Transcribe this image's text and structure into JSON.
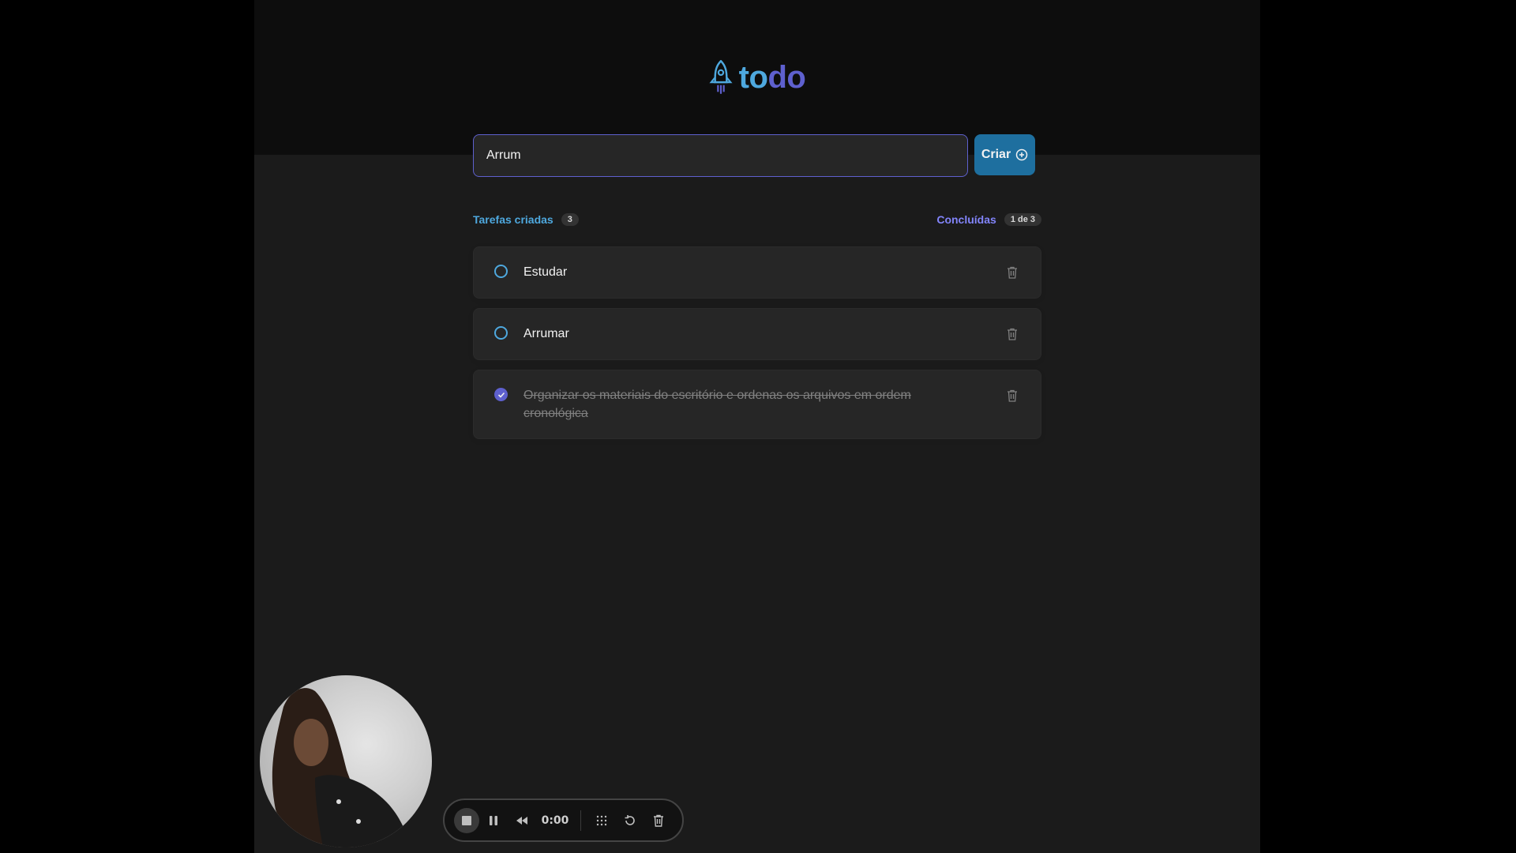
{
  "app": {
    "logo_part1": "to",
    "logo_part2": "do"
  },
  "new_task": {
    "value": "Arrum",
    "create_label": "Criar"
  },
  "info": {
    "created_label": "Tarefas criadas",
    "created_count": "3",
    "done_label": "Concluídas",
    "done_count": "1 de 3"
  },
  "tasks": [
    {
      "text": "Estudar",
      "done": false
    },
    {
      "text": "Arrumar",
      "done": false
    },
    {
      "text": "Organizar os materiais do escritório e ordenas os arquivos em ordem cronológica",
      "done": true
    }
  ],
  "recorder": {
    "time": "0:00",
    "icons": [
      "stop-icon",
      "pause-icon",
      "rewind-icon",
      "time-value",
      "grid-icon",
      "restart-icon",
      "trash-icon"
    ]
  },
  "colors": {
    "blue": "#4ea8de",
    "purple": "#5e60ce",
    "purple_light": "#8284fa",
    "button": "#1e6f9f"
  }
}
